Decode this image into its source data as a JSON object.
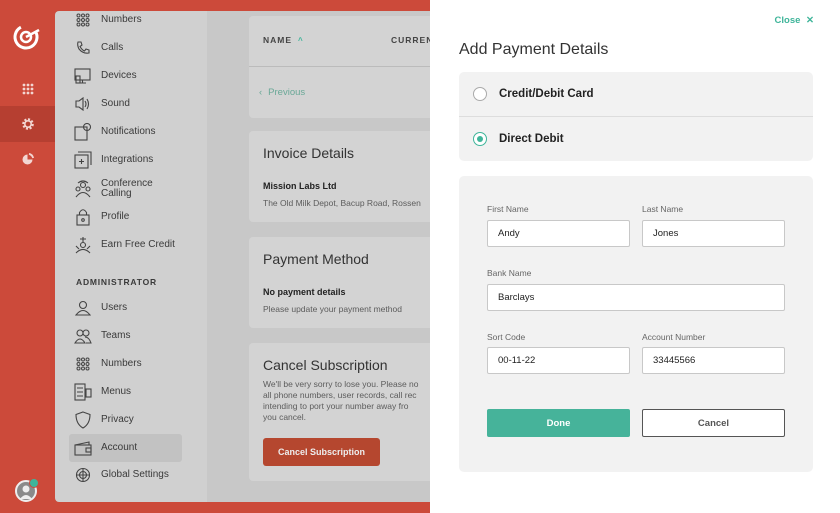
{
  "rail": {
    "icons": [
      {
        "name": "apps-grid-icon",
        "glyph": "⋮⋮⋮"
      },
      {
        "name": "settings-gear-icon",
        "glyph": "⚙"
      },
      {
        "name": "analytics-pie-icon",
        "glyph": "◔"
      }
    ]
  },
  "sidebar": {
    "items": [
      {
        "label": "Numbers",
        "icon": "numbers-grid-icon"
      },
      {
        "label": "Calls",
        "icon": "phone-icon"
      },
      {
        "label": "Devices",
        "icon": "devices-icon"
      },
      {
        "label": "Sound",
        "icon": "speaker-icon"
      },
      {
        "label": "Notifications",
        "icon": "notification-icon"
      },
      {
        "label": "Integrations",
        "icon": "integrations-icon"
      },
      {
        "label": "Conference Calling",
        "icon": "conference-icon"
      },
      {
        "label": "Profile",
        "icon": "lock-icon"
      },
      {
        "label": "Earn Free Credit",
        "icon": "credit-icon"
      }
    ],
    "admin_section": "ADMINISTRATOR",
    "admin_items": [
      {
        "label": "Users",
        "icon": "user-icon"
      },
      {
        "label": "Teams",
        "icon": "teams-icon"
      },
      {
        "label": "Numbers",
        "icon": "numbers-grid-icon"
      },
      {
        "label": "Menus",
        "icon": "menus-icon"
      },
      {
        "label": "Privacy",
        "icon": "shield-icon"
      },
      {
        "label": "Account",
        "icon": "account-icon"
      },
      {
        "label": "Global Settings",
        "icon": "globe-icon"
      }
    ]
  },
  "main": {
    "table": {
      "col_name": "NAME",
      "col_currency": "CURREN",
      "previous": "Previous"
    },
    "invoice": {
      "title": "Invoice Details",
      "company": "Mission Labs Ltd",
      "address": "The Old Milk Depot, Bacup Road, Rossen"
    },
    "payment": {
      "title": "Payment Method",
      "status": "No payment details",
      "hint": "Please update your payment method"
    },
    "cancel": {
      "title": "Cancel Subscription",
      "lines": [
        "We'll be very sorry to lose you. Please no",
        "all phone numbers, user records, call rec",
        "intending to port your number away fro",
        "you cancel."
      ],
      "button": "Cancel Subscription"
    }
  },
  "panel": {
    "close": "Close",
    "title": "Add Payment Details",
    "options": [
      {
        "label": "Credit/Debit Card",
        "selected": false
      },
      {
        "label": "Direct Debit",
        "selected": true
      }
    ],
    "form": {
      "first_name_label": "First Name",
      "first_name": "Andy",
      "last_name_label": "Last Name",
      "last_name": "Jones",
      "bank_label": "Bank Name",
      "bank": "Barclays",
      "sort_label": "Sort Code",
      "sort": "00-11-22",
      "account_label": "Account Number",
      "account": "33445566",
      "done": "Done",
      "cancel": "Cancel"
    }
  }
}
